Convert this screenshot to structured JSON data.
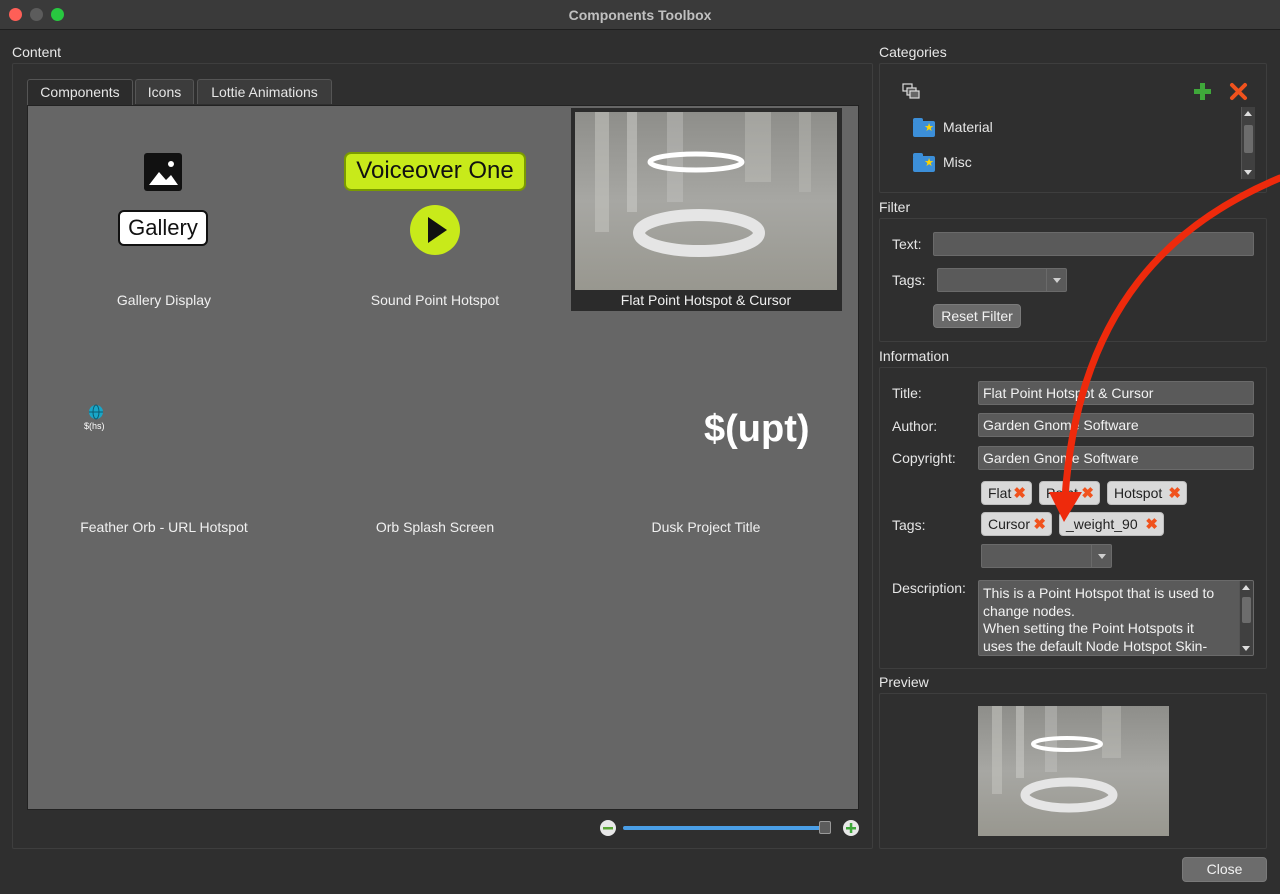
{
  "window": {
    "title": "Components Toolbox"
  },
  "content": {
    "label": "Content",
    "tabs": [
      {
        "label": "Components",
        "active": true
      },
      {
        "label": "Icons",
        "active": false
      },
      {
        "label": "Lottie Animations",
        "active": false
      }
    ],
    "items": [
      {
        "caption": "Gallery Display",
        "badge": "Gallery"
      },
      {
        "caption": "Sound Point Hotspot",
        "badge": "Voiceover One"
      },
      {
        "caption": "Flat Point Hotspot & Cursor",
        "selected": true
      },
      {
        "caption": "Feather Orb - URL Hotspot",
        "badge": "$(hs)"
      },
      {
        "caption": "Orb Splash Screen"
      },
      {
        "caption": "Dusk Project Title",
        "badge": "$(upt)"
      }
    ],
    "zoom_slider": {
      "value_fraction": 0.97
    }
  },
  "categories": {
    "label": "Categories",
    "items": [
      {
        "label": "Material"
      },
      {
        "label": "Misc"
      }
    ]
  },
  "filter": {
    "label": "Filter",
    "text_label": "Text:",
    "text_value": "",
    "tags_label": "Tags:",
    "reset_button": "Reset Filter"
  },
  "information": {
    "label": "Information",
    "title_label": "Title:",
    "title_value": "Flat Point Hotspot & Cursor",
    "author_label": "Author:",
    "author_value": "Garden Gnome Software",
    "copyright_label": "Copyright:",
    "copyright_value": "Garden Gnome Software",
    "tags_label": "Tags:",
    "tags": [
      "Flat",
      "Point",
      "Hotspot",
      "Cursor",
      "_weight_90"
    ],
    "description_label": "Description:",
    "description_lines": [
      "This is a Point Hotspot that is used to",
      "change nodes.",
      "When setting the Point Hotspots it",
      "uses the default Node Hotspot Skin-"
    ]
  },
  "preview": {
    "label": "Preview"
  },
  "close_button": "Close",
  "colors": {
    "accent_green": "#c8ea1a",
    "delete_red": "#f0521d",
    "annotation_arrow": "#ee2a0c",
    "add_green": "#3fa83a"
  }
}
